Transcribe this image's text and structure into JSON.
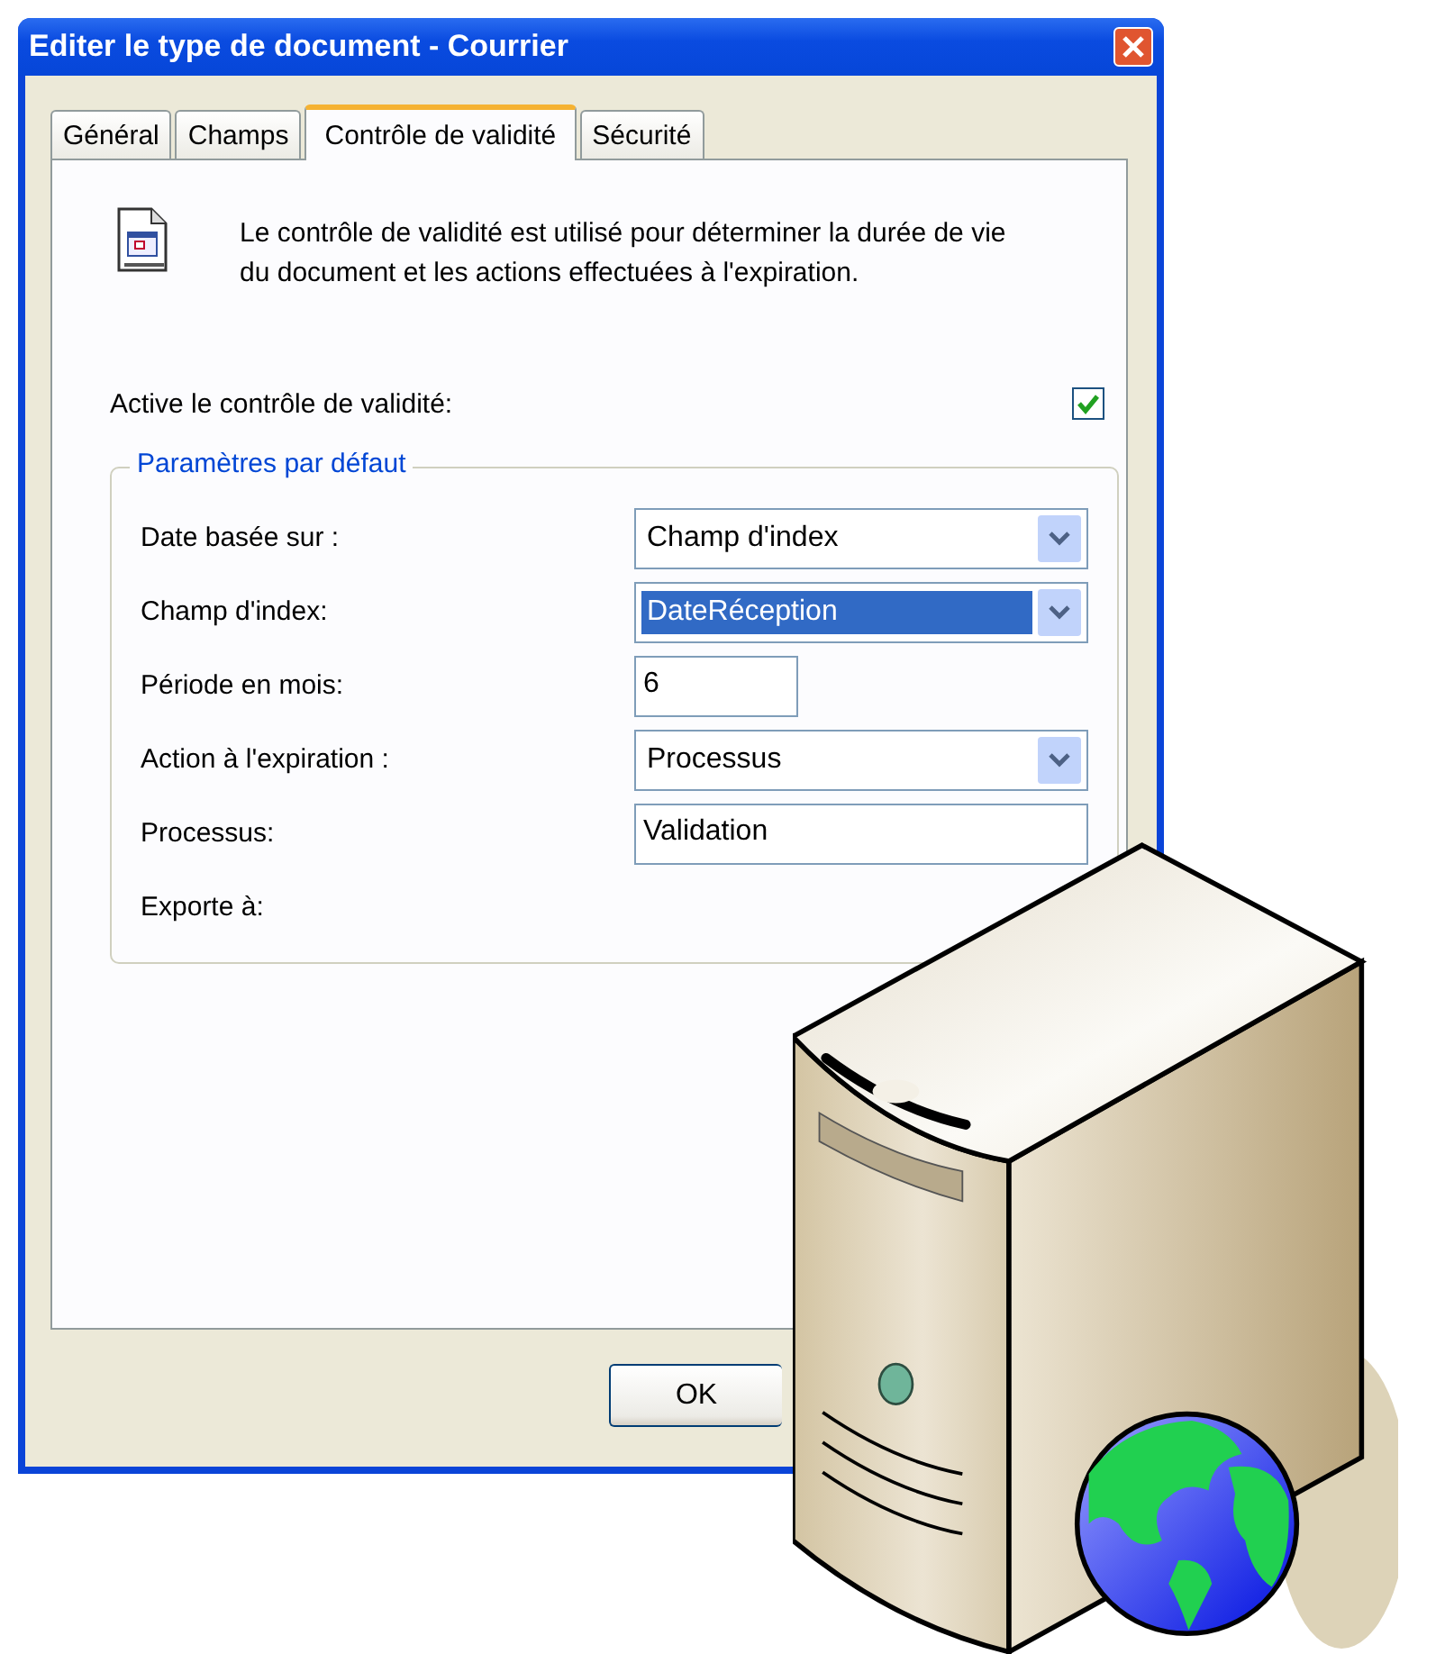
{
  "window": {
    "title": "Editer le type de document - Courrier"
  },
  "tabs": [
    {
      "label": "Général",
      "selected": false
    },
    {
      "label": "Champs",
      "selected": false
    },
    {
      "label": "Contrôle de validité",
      "selected": true
    },
    {
      "label": "Sécurité",
      "selected": false
    }
  ],
  "description": "Le contrôle de validité est utilisé pour déterminer la durée de vie du document et les actions effectuées à l'expiration.",
  "validity_check": {
    "label": "Active le contrôle de validité:",
    "checked": true
  },
  "group": {
    "title": "Paramètres par défaut",
    "rows": [
      {
        "kind": "combo",
        "label": "Date basée sur :",
        "value": "Champ d'index",
        "highlighted": false
      },
      {
        "kind": "combo",
        "label": "Champ d'index:",
        "value": "DateRéception",
        "highlighted": true
      },
      {
        "kind": "number",
        "label": "Période en mois:",
        "value": "6"
      },
      {
        "kind": "combo",
        "label": "Action à l'expiration :",
        "value": "Processus",
        "highlighted": false
      },
      {
        "kind": "text",
        "label": "Processus:",
        "value": "Validation"
      },
      {
        "kind": "label",
        "label": "Exporte à:"
      }
    ]
  },
  "buttons": [
    "OK"
  ]
}
